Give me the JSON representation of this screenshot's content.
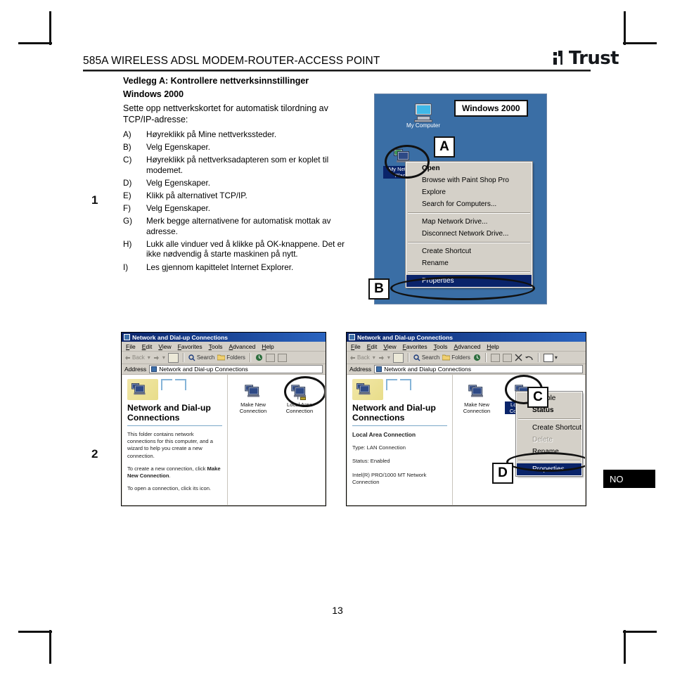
{
  "header": {
    "title": "585A WIRELESS ADSL MODEM-ROUTER-ACCESS POINT",
    "logo_word": "Trust"
  },
  "document": {
    "section_title": "Vedlegg A: Kontrollere nettverksinnstillinger",
    "section_subtitle": "Windows 2000",
    "intro": "Sette opp nettverkskortet for automatisk tilordning av TCP/IP-adresse:",
    "page_number": "13",
    "language_badge": "NO",
    "margin_markers": [
      "1",
      "2"
    ]
  },
  "steps": [
    {
      "label": "A)",
      "text": "Høyreklikk på Mine nettverkssteder."
    },
    {
      "label": "B)",
      "text": "Velg Egenskaper."
    },
    {
      "label": "C)",
      "text": "Høyreklikk på nettverksadapteren som er koplet til modemet."
    },
    {
      "label": "D)",
      "text": "Velg Egenskaper."
    },
    {
      "label": "E)",
      "text": "Klikk på alternativet TCP/IP."
    },
    {
      "label": "F)",
      "text": "Velg Egenskaper."
    },
    {
      "label": "G)",
      "text": "Merk begge alternativene for automatisk mottak av adresse."
    },
    {
      "label": "H)",
      "text": "Lukk alle vinduer ved å klikke på OK-knappene. Det er ikke nødvendig å starte maskinen på nytt."
    },
    {
      "label": "I)",
      "text": "Les gjennom kapittelet Internet Explorer."
    }
  ],
  "callouts": {
    "a": "A",
    "b": "B",
    "c": "C",
    "d": "D"
  },
  "desktop": {
    "os_badge": "Windows 2000",
    "icons": [
      {
        "label": "My Computer",
        "name": "my-computer"
      },
      {
        "label": "My Network Places",
        "name": "my-network-places"
      }
    ],
    "context_menu": [
      {
        "label": "Open",
        "style": "bold"
      },
      {
        "label": "Browse with Paint Shop Pro",
        "style": "normal"
      },
      {
        "label": "Explore",
        "style": "normal"
      },
      {
        "label": "Search for Computers...",
        "style": "normal"
      },
      {
        "label": "sep",
        "style": "sep"
      },
      {
        "label": "Map Network Drive...",
        "style": "normal"
      },
      {
        "label": "Disconnect Network Drive...",
        "style": "normal"
      },
      {
        "label": "sep",
        "style": "sep"
      },
      {
        "label": "Create Shortcut",
        "style": "normal"
      },
      {
        "label": "Rename",
        "style": "normal"
      },
      {
        "label": "sep",
        "style": "sep"
      },
      {
        "label": "Properties",
        "style": "highlight"
      }
    ]
  },
  "window_left": {
    "title": "Network and Dial-up Connections",
    "menu": [
      "File",
      "Edit",
      "View",
      "Favorites",
      "Tools",
      "Advanced",
      "Help"
    ],
    "toolbar": [
      "Back",
      "Forward",
      "Up",
      "Search",
      "Folders",
      "History"
    ],
    "address_label": "Address",
    "address_value": "Network and Dial-up Connections",
    "side_title": "Network and Dial-up Connections",
    "side_paragraph_1": "This folder contains network connections for this computer, and a wizard to help you create a new connection.",
    "side_paragraph_2_pre": "To create a new connection, click ",
    "side_paragraph_2_bold": "Make New Connection",
    "side_paragraph_3": "To open a connection, click its icon.",
    "items": [
      {
        "label": "Make New Connection",
        "name": "make-new-connection"
      },
      {
        "label": "Local Area Connection",
        "name": "local-area-connection"
      }
    ]
  },
  "window_right": {
    "title": "Network and Dial-up Connections",
    "menu": [
      "File",
      "Edit",
      "View",
      "Favorites",
      "Tools",
      "Advanced",
      "Help"
    ],
    "toolbar": [
      "Back",
      "Forward",
      "Up",
      "Search",
      "Folders",
      "History",
      "Move To",
      "Copy To",
      "Delete",
      "Undo",
      "Views"
    ],
    "address_label": "Address",
    "address_value": "Network and Dialup Connections",
    "side_title": "Network and Dial-up Connections",
    "detail_name": "Local Area Connection",
    "detail_type": "Type: LAN Connection",
    "detail_status": "Status: Enabled",
    "detail_adapter": "Intel(R) PRO/1000 MT Network Connection",
    "items": [
      {
        "label": "Make New Connection",
        "name": "make-new-connection"
      },
      {
        "label": "Local Area Connection",
        "name": "local-area-connection"
      }
    ],
    "context_menu": [
      {
        "label": "Disable",
        "style": "normal"
      },
      {
        "label": "Status",
        "style": "bold"
      },
      {
        "label": "sep",
        "style": "sep"
      },
      {
        "label": "Create Shortcut",
        "style": "normal"
      },
      {
        "label": "Delete",
        "style": "dim"
      },
      {
        "label": "Rename",
        "style": "normal"
      },
      {
        "label": "sep",
        "style": "sep"
      },
      {
        "label": "Properties",
        "style": "highlight"
      }
    ]
  },
  "colors": {
    "desktop_blue": "#3a6ea5",
    "menu_highlight": "#0a246a",
    "chrome_grey": "#d4d0c8"
  }
}
